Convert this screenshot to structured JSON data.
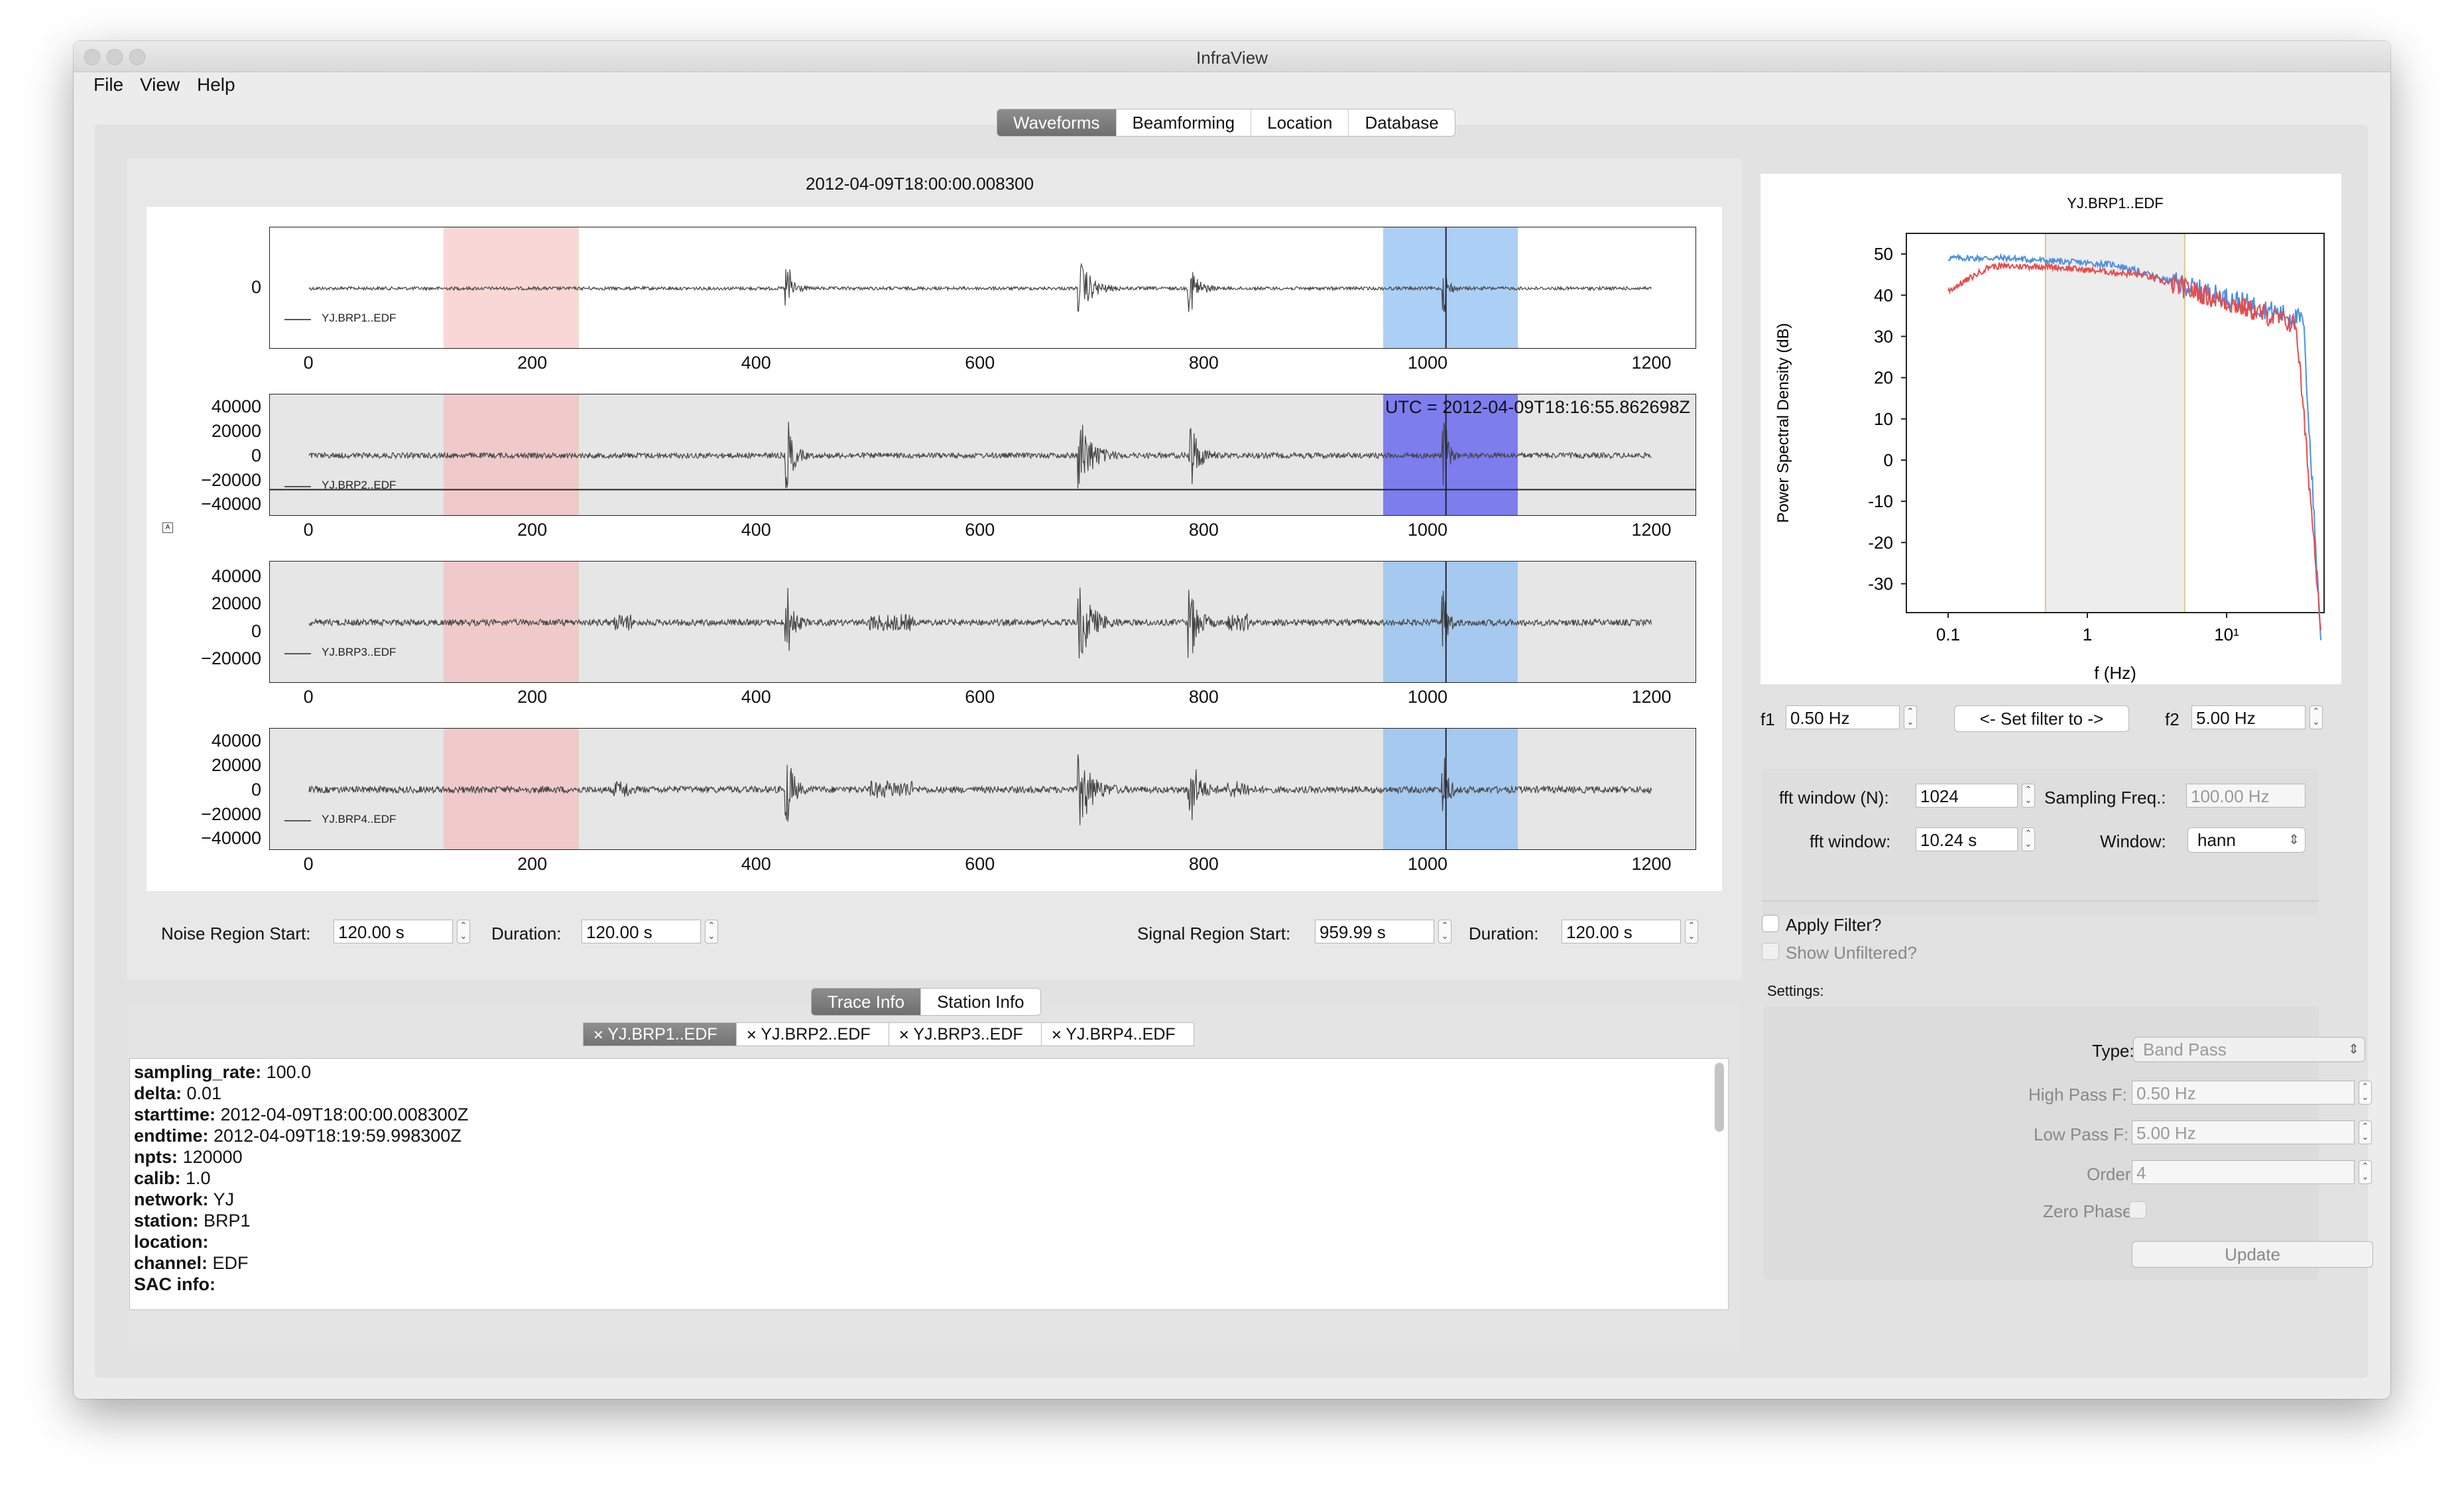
{
  "window": {
    "title": "InfraView"
  },
  "menu": [
    "File",
    "View",
    "Help"
  ],
  "main_tabs": [
    {
      "label": "Waveforms",
      "active": true
    },
    {
      "label": "Beamforming",
      "active": false
    },
    {
      "label": "Location",
      "active": false
    },
    {
      "label": "Database",
      "active": false
    }
  ],
  "waveforms": {
    "start_time": "2012-04-09T18:00:00.008300",
    "cursor_readout": "UTC = 2012-04-09T18:16:55.862698Z",
    "x_range": [
      -35,
      1240
    ],
    "x_ticks": [
      "0",
      "200",
      "400",
      "600",
      "800",
      "1000",
      "1200"
    ],
    "noise_region": [
      120,
      240
    ],
    "signal_region": [
      959.99,
      1079.99
    ],
    "cursor_time": 1015.86,
    "noise_color": "#f7b8b8",
    "signal_color": "#8fbff2",
    "active_signal_color": "#5a5af0",
    "traces": [
      {
        "name": "YJ.BRP1..EDF",
        "y_ticks": [
          "0"
        ],
        "amp": 0.35
      },
      {
        "name": "YJ.BRP2..EDF",
        "y_ticks": [
          "40000",
          "20000",
          "0",
          "−20000",
          "−40000"
        ],
        "amp": 0.45
      },
      {
        "name": "YJ.BRP3..EDF",
        "y_ticks": [
          "40000",
          "20000",
          "0",
          "−20000"
        ],
        "amp": 0.55
      },
      {
        "name": "YJ.BRP4..EDF",
        "y_ticks": [
          "40000",
          "20000",
          "0",
          "−20000",
          "−40000"
        ],
        "amp": 0.6
      }
    ]
  },
  "regions": {
    "noise_start_label": "Noise Region Start:",
    "noise_start": "120.00 s",
    "noise_duration_label": "Duration:",
    "noise_duration": "120.00 s",
    "signal_start_label": "Signal Region Start:",
    "signal_start": "959.99 s",
    "signal_duration_label": "Duration:",
    "signal_duration": "120.00 s"
  },
  "info_tabs": [
    {
      "label": "Trace Info",
      "active": true
    },
    {
      "label": "Station Info",
      "active": false
    }
  ],
  "trace_tabs": [
    "YJ.BRP1..EDF",
    "YJ.BRP2..EDF",
    "YJ.BRP3..EDF",
    "YJ.BRP4..EDF"
  ],
  "trace_info": [
    {
      "key": "sampling_rate",
      "value": " 100.0"
    },
    {
      "key": "delta",
      "value": " 0.01"
    },
    {
      "key": "starttime",
      "value": " 2012-04-09T18:00:00.008300Z"
    },
    {
      "key": "endtime",
      "value": " 2012-04-09T18:19:59.998300Z"
    },
    {
      "key": "npts",
      "value": " 120000"
    },
    {
      "key": "calib",
      "value": " 1.0"
    },
    {
      "key": "network",
      "value": " YJ"
    },
    {
      "key": "station",
      "value": " BRP1"
    },
    {
      "key": "location",
      "value": ""
    },
    {
      "key": "channel",
      "value": " EDF"
    },
    {
      "key": "SAC info",
      "value": ""
    }
  ],
  "psd": {
    "title": "YJ.BRP1..EDF",
    "ylabel": "Power Spectral Density (dB)",
    "xlabel": "f (Hz)",
    "y_ticks": [
      "50",
      "40",
      "30",
      "20",
      "10",
      "0",
      "-10",
      "-20",
      "-30"
    ],
    "x_ticks": [
      "0.1",
      "1",
      "10¹"
    ],
    "filter_band": [
      0.5,
      5.0
    ],
    "series_colors": [
      "#4a90e2",
      "#e84a4a"
    ]
  },
  "filter_controls": {
    "f1_label": "f1",
    "f1": "0.50 Hz",
    "set_filter_label": "<- Set filter to ->",
    "f2_label": "f2",
    "f2": "5.00 Hz"
  },
  "fft": {
    "window_n_label": "fft window (N):",
    "window_n": "1024",
    "sampling_label": "Sampling Freq.:",
    "sampling": "100.00 Hz",
    "window_s_label": "fft window:",
    "window_s": "10.24 s",
    "window_type_label": "Window:",
    "window_type": "hann"
  },
  "filter": {
    "apply_label": "Apply Filter?",
    "show_unfiltered_label": "Show Unfiltered?",
    "settings_label": "Settings:",
    "type_label": "Type:",
    "type": "Band Pass",
    "high_pass_label": "High Pass F:",
    "high_pass": "0.50 Hz",
    "low_pass_label": "Low Pass F:",
    "low_pass": "5.00 Hz",
    "order_label": "Order:",
    "order": "4",
    "zero_phase_label": "Zero Phase",
    "update_label": "Update"
  }
}
